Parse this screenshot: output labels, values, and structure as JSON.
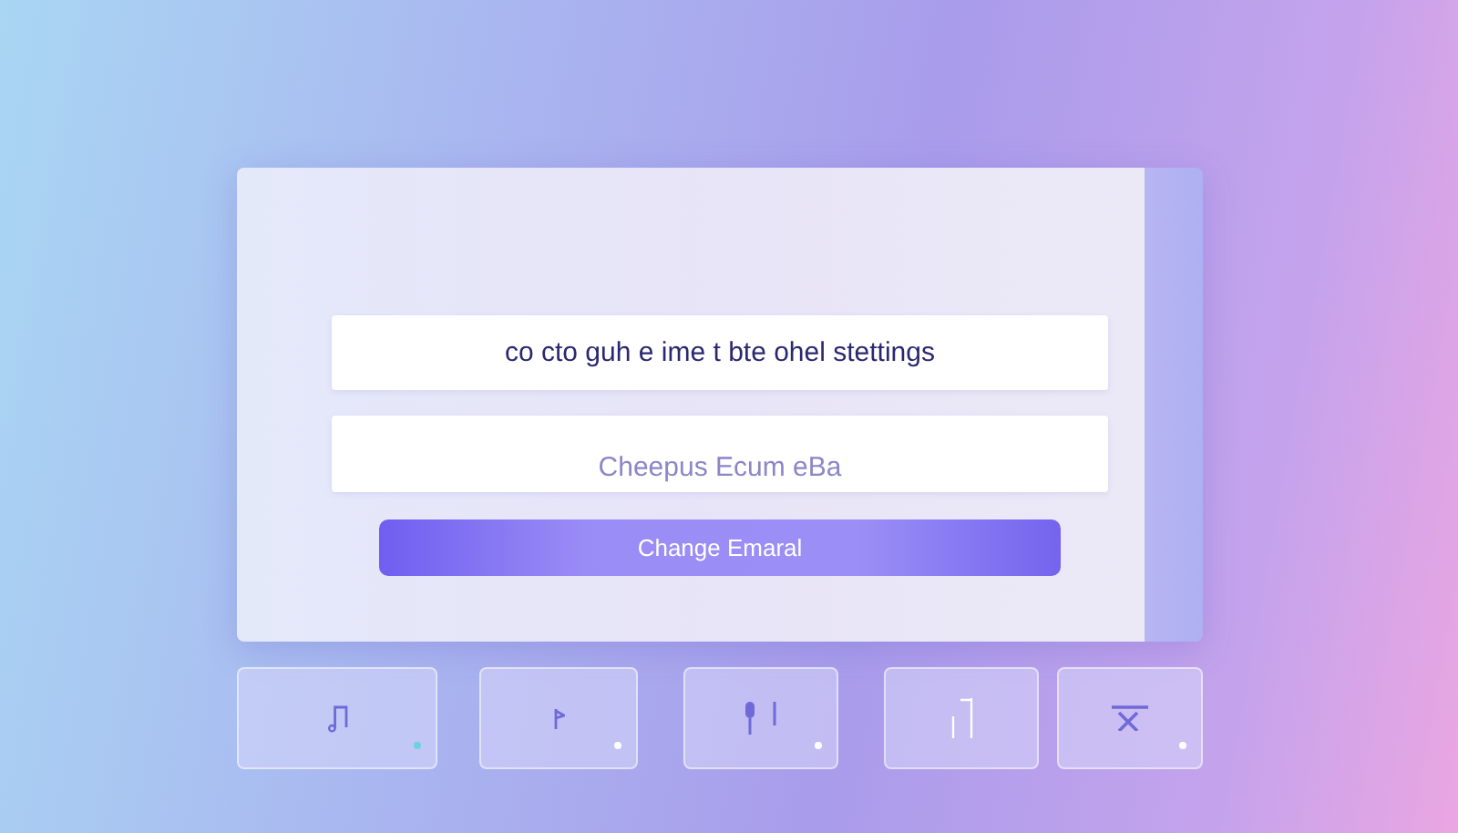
{
  "form": {
    "fields": [
      {
        "value": "co cto guh e ime t bte ohel stettings"
      },
      {
        "placeholder": "Cheepus Ecum eBa"
      }
    ],
    "button": "Change Emaral"
  },
  "tiles": [
    {
      "kind": "notes"
    },
    {
      "kind": "pin"
    },
    {
      "kind": "mic"
    },
    {
      "kind": "bars"
    },
    {
      "kind": "cross"
    }
  ]
}
